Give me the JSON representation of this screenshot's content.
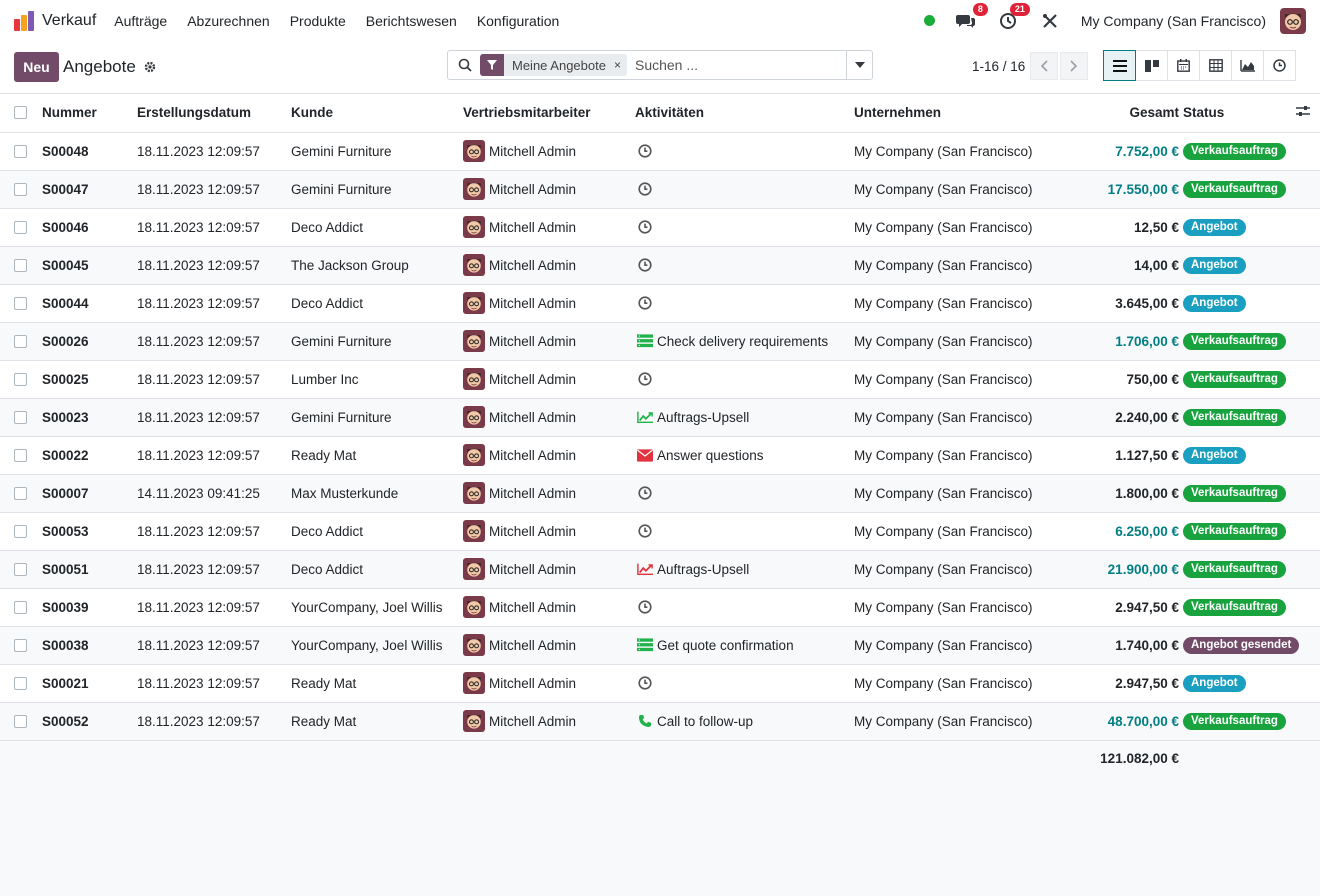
{
  "navbar": {
    "app_name": "Verkauf",
    "menu": [
      "Aufträge",
      "Abzurechnen",
      "Produkte",
      "Berichtswesen",
      "Konfiguration"
    ],
    "messages_count": "8",
    "activities_count": "21",
    "company": "My Company (San Francisco)"
  },
  "control": {
    "new_label": "Neu",
    "title": "Angebote",
    "facet_label": "Meine Angebote",
    "search_placeholder": "Suchen ...",
    "pager": "1-16 / 16"
  },
  "columns": {
    "number": "Nummer",
    "date": "Erstellungsdatum",
    "customer": "Kunde",
    "salesperson": "Vertriebsmitarbeiter",
    "activities": "Aktivitäten",
    "company": "Unternehmen",
    "total": "Gesamt",
    "status": "Status"
  },
  "rows": [
    {
      "number": "S00048",
      "date": "18.11.2023 12:09:57",
      "customer": "Gemini Furniture",
      "salesperson": "Mitchell Admin",
      "activity_icon": "clock-icon",
      "activity": "",
      "company": "My Company (San Francisco)",
      "total": "7.752,00 €",
      "total_style": "blue",
      "status": "Verkaufsauftrag"
    },
    {
      "number": "S00047",
      "date": "18.11.2023 12:09:57",
      "customer": "Gemini Furniture",
      "salesperson": "Mitchell Admin",
      "activity_icon": "clock-icon",
      "activity": "",
      "company": "My Company (San Francisco)",
      "total": "17.550,00 €",
      "total_style": "blue",
      "status": "Verkaufsauftrag"
    },
    {
      "number": "S00046",
      "date": "18.11.2023 12:09:57",
      "customer": "Deco Addict",
      "salesperson": "Mitchell Admin",
      "activity_icon": "clock-icon",
      "activity": "",
      "company": "My Company (San Francisco)",
      "total": "12,50 €",
      "total_style": "black",
      "status": "Angebot"
    },
    {
      "number": "S00045",
      "date": "18.11.2023 12:09:57",
      "customer": "The Jackson Group",
      "salesperson": "Mitchell Admin",
      "activity_icon": "clock-icon",
      "activity": "",
      "company": "My Company (San Francisco)",
      "total": "14,00 €",
      "total_style": "black",
      "status": "Angebot"
    },
    {
      "number": "S00044",
      "date": "18.11.2023 12:09:57",
      "customer": "Deco Addict",
      "salesperson": "Mitchell Admin",
      "activity_icon": "clock-icon",
      "activity": "",
      "company": "My Company (San Francisco)",
      "total": "3.645,00 €",
      "total_style": "black",
      "status": "Angebot"
    },
    {
      "number": "S00026",
      "date": "18.11.2023 12:09:57",
      "customer": "Gemini Furniture",
      "salesperson": "Mitchell Admin",
      "activity_icon": "tasks-icon",
      "activity": "Check delivery requirements",
      "company": "My Company (San Francisco)",
      "total": "1.706,00 €",
      "total_style": "blue",
      "status": "Verkaufsauftrag"
    },
    {
      "number": "S00025",
      "date": "18.11.2023 12:09:57",
      "customer": "Lumber Inc",
      "salesperson": "Mitchell Admin",
      "activity_icon": "clock-icon",
      "activity": "",
      "company": "My Company (San Francisco)",
      "total": "750,00 €",
      "total_style": "black",
      "status": "Verkaufsauftrag"
    },
    {
      "number": "S00023",
      "date": "18.11.2023 12:09:57",
      "customer": "Gemini Furniture",
      "salesperson": "Mitchell Admin",
      "activity_icon": "upsell-green-icon",
      "activity": "Auftrags-Upsell",
      "company": "My Company (San Francisco)",
      "total": "2.240,00 €",
      "total_style": "black",
      "status": "Verkaufsauftrag"
    },
    {
      "number": "S00022",
      "date": "18.11.2023 12:09:57",
      "customer": "Ready Mat",
      "salesperson": "Mitchell Admin",
      "activity_icon": "envelope-icon",
      "activity": "Answer questions",
      "company": "My Company (San Francisco)",
      "total": "1.127,50 €",
      "total_style": "black",
      "status": "Angebot"
    },
    {
      "number": "S00007",
      "date": "14.11.2023 09:41:25",
      "customer": "Max Musterkunde",
      "salesperson": "Mitchell Admin",
      "activity_icon": "clock-icon",
      "activity": "",
      "company": "My Company (San Francisco)",
      "total": "1.800,00 €",
      "total_style": "black",
      "status": "Verkaufsauftrag"
    },
    {
      "number": "S00053",
      "date": "18.11.2023 12:09:57",
      "customer": "Deco Addict",
      "salesperson": "Mitchell Admin",
      "activity_icon": "clock-icon",
      "activity": "",
      "company": "My Company (San Francisco)",
      "total": "6.250,00 €",
      "total_style": "blue",
      "status": "Verkaufsauftrag"
    },
    {
      "number": "S00051",
      "date": "18.11.2023 12:09:57",
      "customer": "Deco Addict",
      "salesperson": "Mitchell Admin",
      "activity_icon": "upsell-red-icon",
      "activity": "Auftrags-Upsell",
      "company": "My Company (San Francisco)",
      "total": "21.900,00 €",
      "total_style": "blue",
      "status": "Verkaufsauftrag"
    },
    {
      "number": "S00039",
      "date": "18.11.2023 12:09:57",
      "customer": "YourCompany, Joel Willis",
      "salesperson": "Mitchell Admin",
      "activity_icon": "clock-icon",
      "activity": "",
      "company": "My Company (San Francisco)",
      "total": "2.947,50 €",
      "total_style": "black",
      "status": "Verkaufsauftrag"
    },
    {
      "number": "S00038",
      "date": "18.11.2023 12:09:57",
      "customer": "YourCompany, Joel Willis",
      "salesperson": "Mitchell Admin",
      "activity_icon": "tasks-icon",
      "activity": "Get quote confirmation",
      "company": "My Company (San Francisco)",
      "total": "1.740,00 €",
      "total_style": "black",
      "status": "Angebot gesendet"
    },
    {
      "number": "S00021",
      "date": "18.11.2023 12:09:57",
      "customer": "Ready Mat",
      "salesperson": "Mitchell Admin",
      "activity_icon": "clock-icon",
      "activity": "",
      "company": "My Company (San Francisco)",
      "total": "2.947,50 €",
      "total_style": "black",
      "status": "Angebot"
    },
    {
      "number": "S00052",
      "date": "18.11.2023 12:09:57",
      "customer": "Ready Mat",
      "salesperson": "Mitchell Admin",
      "activity_icon": "phone-icon",
      "activity": "Call to follow-up",
      "company": "My Company (San Francisco)",
      "total": "48.700,00 €",
      "total_style": "blue",
      "status": "Verkaufsauftrag"
    }
  ],
  "footer": {
    "grand_total": "121.082,00 €"
  },
  "colors": {
    "brand": "#714b67",
    "accent": "#017e84",
    "status_order": "#18a33e",
    "status_quote": "#1a9fc0",
    "status_sent": "#714b67"
  }
}
